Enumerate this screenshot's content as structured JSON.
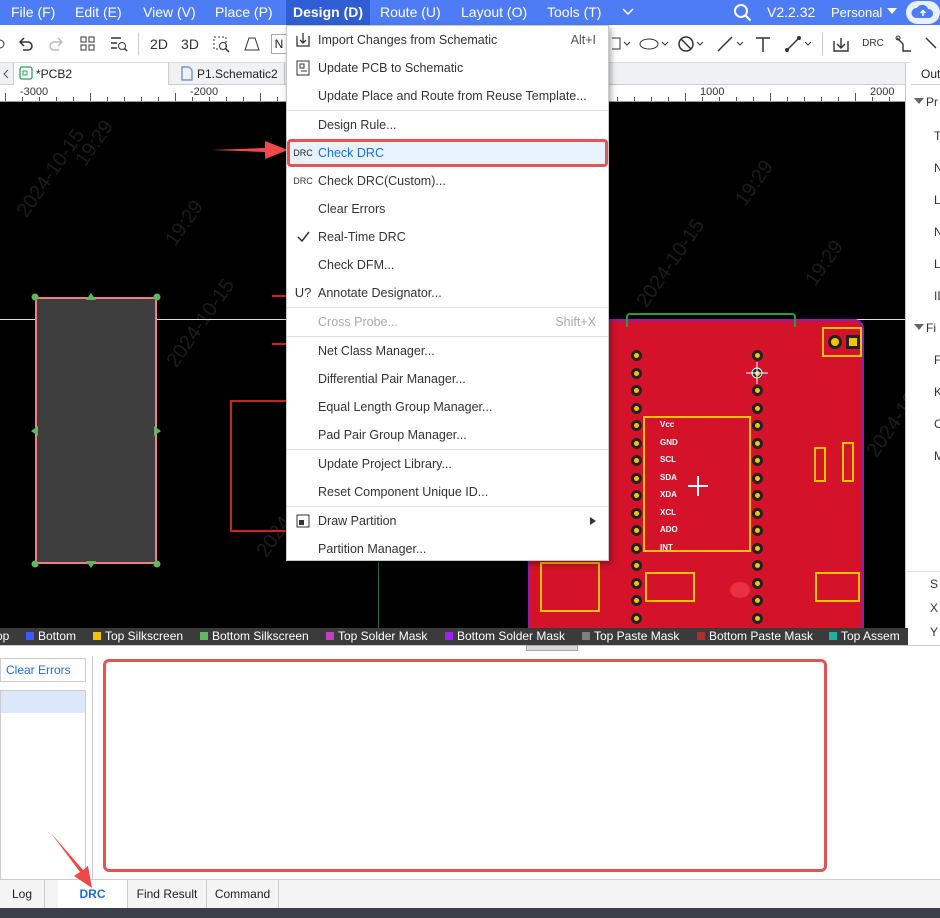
{
  "menubar": {
    "items": [
      "File (F)",
      "Edit (E)",
      "View (V)",
      "Place (P)",
      "Design (D)",
      "Route (U)",
      "Layout (O)",
      "Tools (T)"
    ],
    "version": "V2.2.32",
    "account": "Personal"
  },
  "toolbar": {
    "view2d": "2D",
    "view3d": "3D",
    "truncated": "N",
    "drc": "DRC"
  },
  "tabs": {
    "pcb": "*PCB2",
    "schematic": "P1.Schematic2"
  },
  "ruler": [
    "-3000",
    "-2000",
    "1000",
    "2000"
  ],
  "right_panel": {
    "title": "Outli",
    "rows": [
      "Pr",
      "T",
      "N",
      "L",
      "N",
      "L",
      "ID",
      "Fi",
      "F",
      "K",
      "C",
      "M",
      "S",
      "X",
      "Y"
    ]
  },
  "design_menu": {
    "items": [
      {
        "label": "Import Changes from Schematic",
        "shortcut": "Alt+I"
      },
      {
        "label": "Update PCB to Schematic"
      },
      {
        "label": "Update Place and Route from Reuse Template..."
      },
      {
        "label": "Design Rule..."
      },
      {
        "label": "Check DRC",
        "icon": "DRC"
      },
      {
        "label": "Check DRC(Custom)...",
        "icon": "DRC"
      },
      {
        "label": "Clear Errors"
      },
      {
        "label": "Real-Time DRC"
      },
      {
        "label": "Check DFM..."
      },
      {
        "label": "Annotate Designator...",
        "icon": "U?"
      },
      {
        "label": "Cross Probe...",
        "shortcut": "Shift+X"
      },
      {
        "label": "Net Class Manager..."
      },
      {
        "label": "Differential Pair Manager..."
      },
      {
        "label": "Equal Length Group Manager..."
      },
      {
        "label": "Pad Pair Group Manager..."
      },
      {
        "label": "Update Project Library..."
      },
      {
        "label": "Reset Component Unique ID..."
      },
      {
        "label": "Draw Partition"
      },
      {
        "label": "Partition Manager..."
      }
    ]
  },
  "layers": [
    "op",
    "Bottom",
    "Top Silkscreen",
    "Bottom Silkscreen",
    "Top Solder Mask",
    "Bottom Solder Mask",
    "Top Paste Mask",
    "Bottom Paste Mask",
    "Top Assem"
  ],
  "layer_colors": [
    "#ffffff",
    "#3b5bff",
    "#f5c400",
    "#5fb85f",
    "#c040c0",
    "#a020f0",
    "#808080",
    "#b03030",
    "#20b0a0"
  ],
  "pcb_labels": [
    "Vcc",
    "GND",
    "SCL",
    "SDA",
    "XDA",
    "XCL",
    "ADO",
    "INT"
  ],
  "bottom_panel": {
    "clear_errors": "Clear Errors",
    "tabs": [
      "Log",
      "DRC",
      "Find Result",
      "Command"
    ]
  }
}
